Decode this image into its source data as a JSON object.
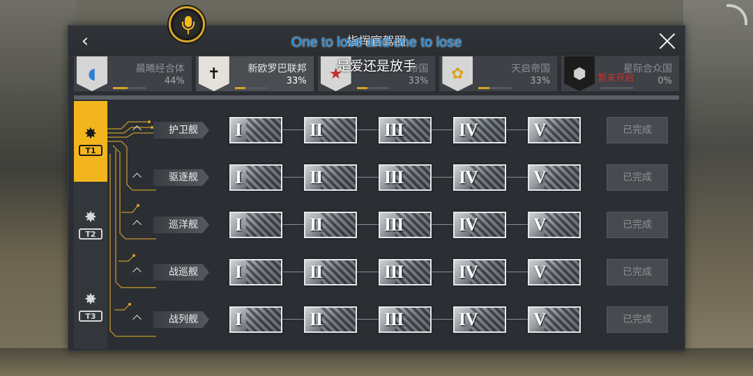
{
  "window": {
    "title": "指挥官驾照"
  },
  "lyrics": {
    "english": "One to love and one to lose",
    "chinese": "是爱还是放手"
  },
  "colors": {
    "accent": "#f2b51d",
    "lyric_blue": "#1f8fe0",
    "locked_red": "#c8342c"
  },
  "factions": [
    {
      "name": "晨曦经合体",
      "percent": "44%",
      "progress": 0.44,
      "icon": "dawn-emblem-icon",
      "color": "#2f7fd2",
      "selected": false
    },
    {
      "name": "新欧罗巴联邦",
      "percent": "33%",
      "progress": 0.33,
      "icon": "cross-emblem-icon",
      "color": "#d9d6d0",
      "selected": true
    },
    {
      "name": "帝国",
      "percent": "33%",
      "progress": 0.33,
      "icon": "star-emblem-icon",
      "color": "#c52f2a",
      "selected": false
    },
    {
      "name": "天启帝国",
      "percent": "33%",
      "progress": 0.33,
      "icon": "apocalypse-emblem-icon",
      "color": "#d9a324",
      "selected": false
    },
    {
      "name": "星际合众国",
      "percent": "0%",
      "progress": 0,
      "icon": "hexagon-emblem-icon",
      "color": "#2a2a2a",
      "selected": false,
      "locked_text": "暂未开启"
    }
  ],
  "tiers": [
    {
      "label": "T1",
      "icon": "network-node-icon",
      "active": true
    },
    {
      "label": "T2",
      "icon": "network-node-icon",
      "active": false
    },
    {
      "label": "T3",
      "icon": "network-node-icon",
      "active": false
    }
  ],
  "ship_rows": [
    {
      "name": "护卫舰",
      "levels": [
        "I",
        "II",
        "III",
        "IV",
        "V"
      ],
      "status": "已完成"
    },
    {
      "name": "驱逐舰",
      "levels": [
        "I",
        "II",
        "III",
        "IV",
        "V"
      ],
      "status": "已完成"
    },
    {
      "name": "巡洋舰",
      "levels": [
        "I",
        "II",
        "III",
        "IV",
        "V"
      ],
      "status": "已完成"
    },
    {
      "name": "战巡舰",
      "levels": [
        "I",
        "II",
        "III",
        "IV",
        "V"
      ],
      "status": "已完成"
    },
    {
      "name": "战列舰",
      "levels": [
        "I",
        "II",
        "III",
        "IV",
        "V"
      ],
      "status": "已完成"
    }
  ]
}
